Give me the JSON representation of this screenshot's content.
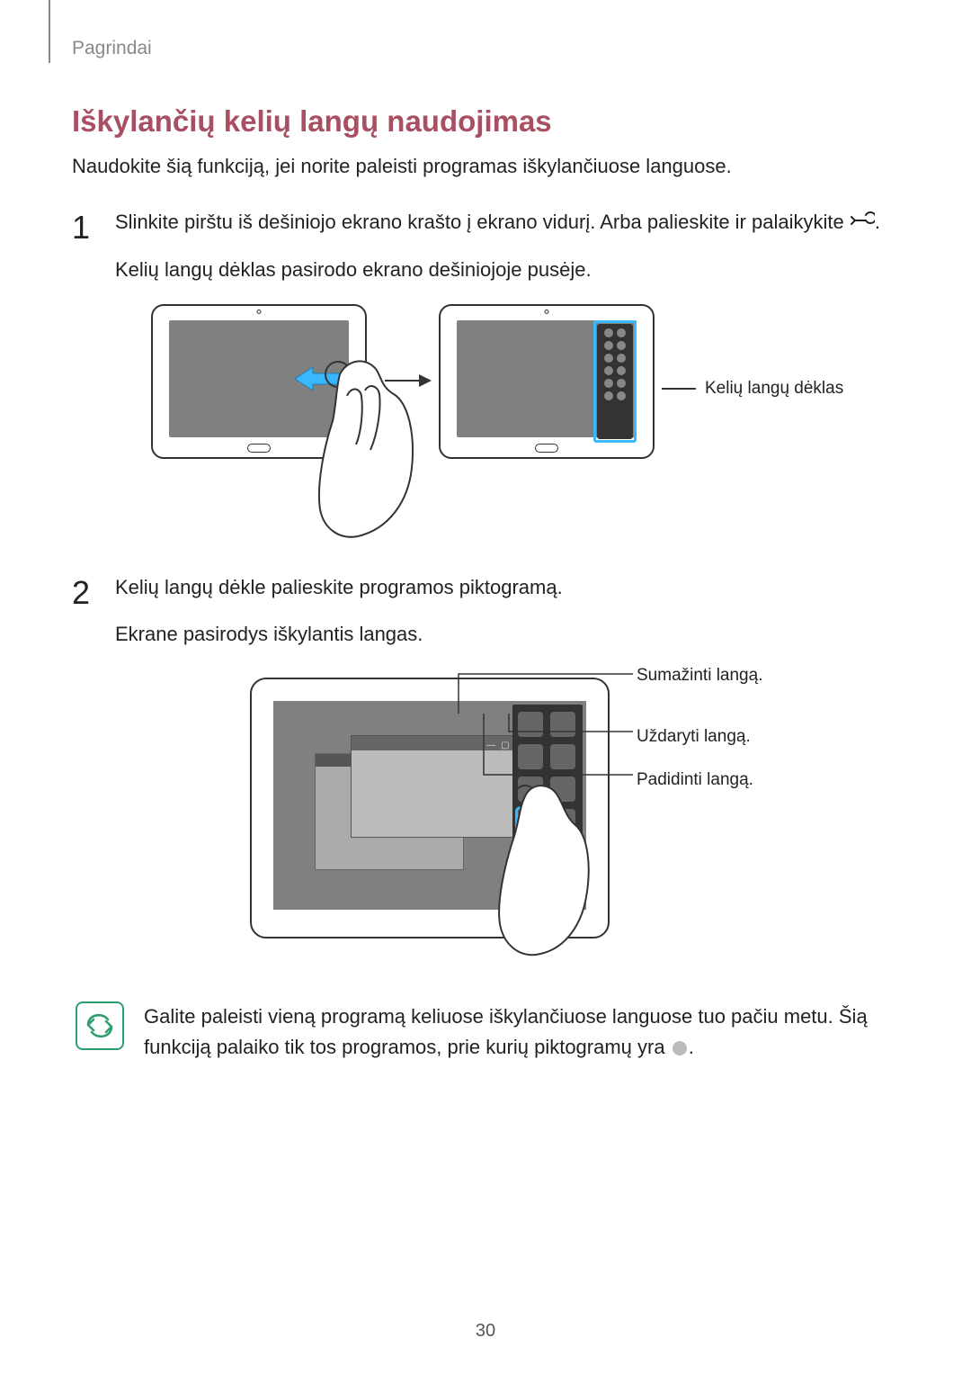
{
  "breadcrumb": "Pagrindai",
  "title": "Iškylančių kelių langų naudojimas",
  "intro": "Naudokite šią funkciją, jei norite paleisti programas iškylančiuose languose.",
  "steps": [
    {
      "num": "1",
      "text_a": "Slinkite pirštu iš dešiniojo ekrano krašto į ekrano vidurį. Arba palieskite ir palaikykite ",
      "text_b": ".",
      "text_c": "Kelių langų dėklas pasirodo ekrano dešiniojoje pusėje."
    },
    {
      "num": "2",
      "text_a": "Kelių langų dėkle palieskite programos piktogramą.",
      "text_c": "Ekrane pasirodys iškylantis langas."
    }
  ],
  "callouts": {
    "tray": "Kelių langų dėklas",
    "min": "Sumažinti langą.",
    "close": "Uždaryti langą.",
    "max": "Padidinti langą."
  },
  "note": {
    "text_a": "Galite paleisti vieną programą keliuose iškylančiuose languose tuo pačiu metu. Šią funkciją palaiko tik tos programos, prie kurių piktogramų yra ",
    "text_b": "."
  },
  "page_number": "30"
}
